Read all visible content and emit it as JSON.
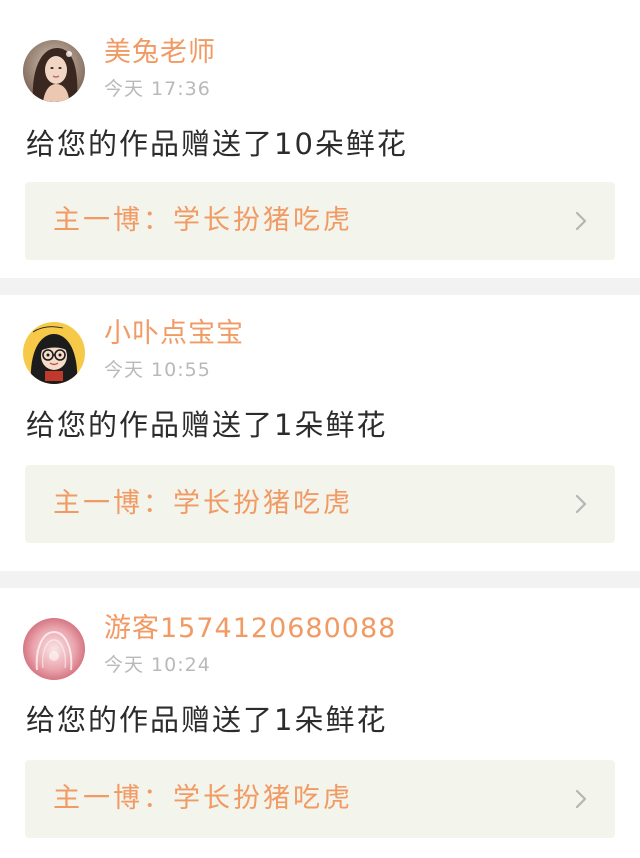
{
  "colors": {
    "accent": "#f19a63",
    "message_text": "#2c2c2c",
    "timestamp": "#b9b9b9",
    "link_bg": "#f3f4ec",
    "page_bg": "#f2f2f2"
  },
  "notifications": [
    {
      "username": "美兔老师",
      "time": "今天 17:36",
      "message": "给您的作品赠送了10朵鲜花",
      "work_title": "主一博：学长扮猪吃虎",
      "avatar_icon": "user-photo-avatar",
      "chevron_icon": "chevron-right-icon"
    },
    {
      "username": "小卟点宝宝",
      "time": "今天 10:55",
      "message": "给您的作品赠送了1朵鲜花",
      "work_title": "主一博：学长扮猪吃虎",
      "avatar_icon": "cartoon-girl-avatar",
      "chevron_icon": "chevron-right-icon"
    },
    {
      "username": "游客1574120680088",
      "time": "今天 10:24",
      "message": "给您的作品赠送了1朵鲜花",
      "work_title": "主一博：学长扮猪吃虎",
      "avatar_icon": "pink-blur-avatar",
      "chevron_icon": "chevron-right-icon"
    }
  ]
}
